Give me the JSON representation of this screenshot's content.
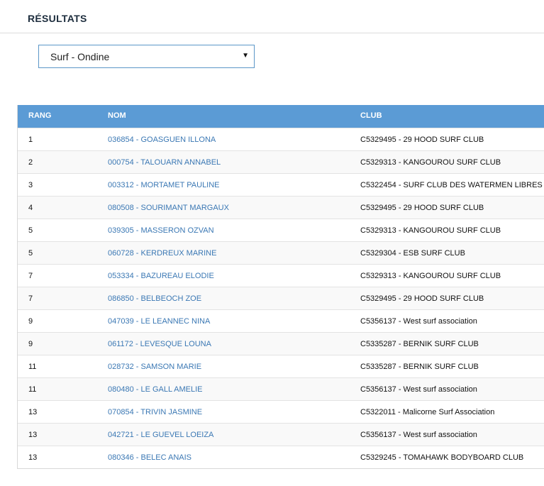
{
  "header": {
    "title": "RÉSULTATS"
  },
  "filter": {
    "selected": "Surf - Ondine"
  },
  "table": {
    "columns": [
      "RANG",
      "NOM",
      "CLUB"
    ],
    "rows": [
      {
        "rang": "1",
        "nom": "036854 - GOASGUEN ILLONA",
        "club": "C5329495 - 29 HOOD SURF CLUB"
      },
      {
        "rang": "2",
        "nom": "000754 - TALOUARN ANNABEL",
        "club": "C5329313 - KANGOUROU SURF CLUB"
      },
      {
        "rang": "3",
        "nom": "003312 - MORTAMET PAULINE",
        "club": "C5322454 - SURF CLUB DES WATERMEN LIBRES"
      },
      {
        "rang": "4",
        "nom": "080508 - SOURIMANT MARGAUX",
        "club": "C5329495 - 29 HOOD SURF CLUB"
      },
      {
        "rang": "5",
        "nom": "039305 - MASSERON OZVAN",
        "club": "C5329313 - KANGOUROU SURF CLUB"
      },
      {
        "rang": "5",
        "nom": "060728 - KERDREUX MARINE",
        "club": "C5329304 - ESB SURF CLUB"
      },
      {
        "rang": "7",
        "nom": "053334 - BAZUREAU ELODIE",
        "club": "C5329313 - KANGOUROU SURF CLUB"
      },
      {
        "rang": "7",
        "nom": "086850 - BELBEOCH ZOE",
        "club": "C5329495 - 29 HOOD SURF CLUB"
      },
      {
        "rang": "9",
        "nom": "047039 - LE LEANNEC NINA",
        "club": "C5356137 - West surf association"
      },
      {
        "rang": "9",
        "nom": "061172 - LEVESQUE LOUNA",
        "club": "C5335287 - BERNIK SURF CLUB"
      },
      {
        "rang": "11",
        "nom": "028732 - SAMSON MARIE",
        "club": "C5335287 - BERNIK SURF CLUB"
      },
      {
        "rang": "11",
        "nom": "080480 - LE GALL AMELIE",
        "club": "C5356137 - West surf association"
      },
      {
        "rang": "13",
        "nom": "070854 - TRIVIN JASMINE",
        "club": "C5322011 - Malicorne Surf Association"
      },
      {
        "rang": "13",
        "nom": "042721 - LE GUEVEL LOEIZA",
        "club": "C5356137 - West surf association"
      },
      {
        "rang": "13",
        "nom": "080346 - BELEC ANAIS",
        "club": "C5329245 - TOMAHAWK BODYBOARD CLUB"
      }
    ]
  },
  "colors": {
    "header_bg": "#5b9bd5",
    "link": "#3b78b4",
    "select_border": "#5b96c8"
  }
}
